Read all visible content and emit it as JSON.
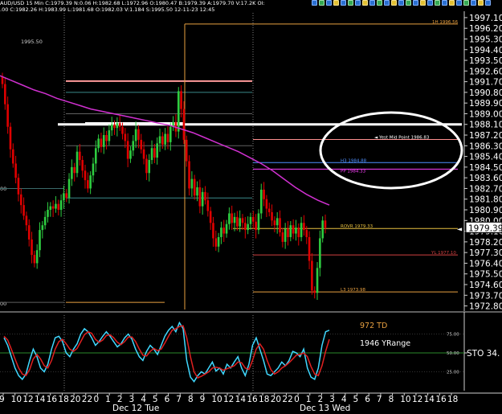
{
  "header": {
    "line1": "AUD/USD  15 Min  C:1979.39  N:0.06  H:1982.68  L:1972.96  O:1980.47  B:1979.39  A:1979.70  V:17.2K  OI:",
    "line2": ".00  C:1982.26  H:1983.99  L:1981.68  O:1982.03  V:1.184  S:1995.50  12-11-23  12:45"
  },
  "colors": {
    "background": "#000000",
    "candle_up": "#2ecc40",
    "candle_down": "#e00000",
    "moving_average": "#d030d0",
    "axis_text": "#ffffff",
    "level_orange": "#e8a040",
    "level_red": "#d04040",
    "level_blue": "#5090ff",
    "level_magenta": "#ff40ff",
    "level_pink": "#ff9090",
    "stoch_fast": "#40d8ff",
    "stoch_slow": "#e02020",
    "stoch_ref": "#2a8a2a",
    "sep_dotted": "#808080"
  },
  "chart_data": [
    {
      "type": "candlestick",
      "title": "AUD/USD 15 Min",
      "ylim": [
        1972.5,
        1997.5
      ],
      "y_ticks": [
        "1997.10",
        "1996.20",
        "1995.30",
        "1994.40",
        "1993.50",
        "1992.60",
        "1991.70",
        "1990.80",
        "1989.90",
        "1989.00",
        "1988.10",
        "1987.20",
        "1986.30",
        "1985.40",
        "1984.50",
        "1983.60",
        "1982.70",
        "1981.80",
        "1980.90",
        "1980.00",
        "1979.10",
        "1978.20",
        "1977.30",
        "1976.40",
        "1975.50",
        "1974.60",
        "1973.70",
        "1972.80"
      ],
      "left_edge_labels": [
        "1995.50",
        "00",
        "00"
      ],
      "current_price": "1979.39",
      "closes": [
        1991.5,
        1989.8,
        1987.9,
        1986.0,
        1984.8,
        1983.6,
        1982.2,
        1981.3,
        1980.4,
        1979.6,
        1978.4,
        1977.1,
        1976.4,
        1977.5,
        1979.2,
        1979.6,
        1980.3,
        1980.9,
        1981.2,
        1981.0,
        1981.4,
        1980.9,
        1981.7,
        1982.3,
        1981.9,
        1983.5,
        1984.5,
        1984.0,
        1985.8,
        1985.1,
        1984.2,
        1983.4,
        1982.7,
        1983.8,
        1984.8,
        1986.1,
        1986.9,
        1986.2,
        1987.2,
        1986.7,
        1987.6,
        1988.1,
        1987.8,
        1988.2,
        1987.9,
        1987.3,
        1986.7,
        1985.2,
        1985.9,
        1986.7,
        1987.7,
        1986.8,
        1986.0,
        1985.2,
        1984.0,
        1985.1,
        1986.1,
        1985.3,
        1986.5,
        1987.1,
        1986.4,
        1987.3,
        1986.6,
        1987.9,
        1988.3,
        1987.5,
        1990.9,
        1989.4,
        1986.8,
        1985.0,
        1982.7,
        1983.5,
        1982.1,
        1982.8,
        1981.2,
        1982.4,
        1981.7,
        1980.8,
        1979.8,
        1978.5,
        1977.8,
        1978.6,
        1979.4,
        1978.9,
        1979.7,
        1980.6,
        1979.8,
        1980.3,
        1979.5,
        1980.2,
        1979.8,
        1979.2,
        1979.7,
        1980.3,
        1979.9,
        1979.2,
        1980.6,
        1982.6,
        1981.8,
        1981.0,
        1980.7,
        1980.0,
        1979.6,
        1980.2,
        1979.0,
        1978.2,
        1979.3,
        1978.6,
        1979.6,
        1978.9,
        1979.4,
        1978.6,
        1979.8,
        1979.2,
        1978.6,
        1976.6,
        1974.1,
        1973.9,
        1976.0,
        1978.5,
        1980.0,
        1979.39
      ],
      "moving_average": [
        1992.2,
        1991.8,
        1991.4,
        1991.0,
        1990.7,
        1990.3,
        1990.0,
        1989.7,
        1989.4,
        1989.2,
        1989.0,
        1988.8,
        1988.6,
        1988.4,
        1988.2,
        1988.0,
        1987.7,
        1987.4,
        1987.0,
        1986.6,
        1986.2,
        1985.8,
        1985.3,
        1984.8,
        1984.2,
        1983.5,
        1982.8,
        1982.2,
        1981.7,
        1981.3
      ],
      "levels": [
        {
          "label": "1H 1996.56",
          "value": 1996.56,
          "color": "#e8a040"
        },
        {
          "label": "Yest Mid Point 1986.83",
          "value": 1986.83,
          "color": "#ff9090",
          "marker": "◄"
        },
        {
          "label": "H3 1984.88",
          "value": 1984.88,
          "color": "#5090ff"
        },
        {
          "label": "PP 1984.33",
          "value": 1984.33,
          "color": "#ff40ff"
        },
        {
          "label": "ROVR 1979.33",
          "value": 1979.33,
          "color": "#e8c040"
        },
        {
          "label": "YL 1977.10",
          "value": 1977.1,
          "color": "#d04040"
        },
        {
          "label": "L3 1973.98",
          "value": 1973.98,
          "color": "#e8a040"
        }
      ],
      "highlight_line": 1988.1
    },
    {
      "type": "line",
      "series": [
        {
          "name": "",
          "color": "#40d8ff",
          "values": [
            70,
            60,
            45,
            30,
            20,
            15,
            22,
            40,
            55,
            45,
            30,
            25,
            35,
            55,
            70,
            72,
            65,
            50,
            45,
            55,
            62,
            75,
            82,
            78,
            70,
            60,
            65,
            72,
            78,
            72,
            65,
            58,
            62,
            70,
            75,
            68,
            55,
            45,
            40,
            52,
            60,
            55,
            48,
            60,
            72,
            80,
            85,
            78,
            90,
            82,
            40,
            18,
            12,
            20,
            25,
            22,
            30,
            38,
            26,
            30,
            22,
            35,
            30,
            38,
            45,
            30,
            20,
            35,
            60,
            70,
            55,
            40,
            22,
            20,
            25,
            30,
            38,
            33,
            40,
            52,
            50,
            45,
            55,
            30,
            18,
            15,
            30,
            60,
            78,
            80
          ]
        },
        {
          "name": "",
          "color": "#e02020",
          "values": [
            72,
            67,
            55,
            42,
            30,
            22,
            20,
            28,
            42,
            48,
            42,
            33,
            30,
            40,
            55,
            65,
            68,
            62,
            55,
            52,
            56,
            65,
            74,
            78,
            76,
            68,
            64,
            67,
            73,
            74,
            70,
            64,
            61,
            65,
            71,
            71,
            65,
            55,
            47,
            46,
            52,
            56,
            53,
            55,
            63,
            72,
            80,
            82,
            85,
            86,
            70,
            45,
            25,
            17,
            19,
            22,
            25,
            30,
            31,
            30,
            27,
            29,
            31,
            33,
            38,
            37,
            30,
            28,
            40,
            55,
            62,
            55,
            40,
            28,
            22,
            25,
            30,
            33,
            37,
            42,
            47,
            48,
            50,
            45,
            32,
            22,
            20,
            33,
            52,
            68
          ]
        }
      ],
      "ylim": [
        0,
        100
      ],
      "ref_lines": [
        25,
        50,
        75
      ],
      "right_labels": [
        "75.00",
        "50.00",
        "25.00"
      ],
      "annotations": [
        "972 TD",
        "1946 YRange"
      ],
      "right_tag": "STO  34."
    }
  ],
  "x_axis": {
    "labels": [
      "9",
      "10",
      "12",
      "14",
      "16",
      "18",
      "20",
      "22",
      "0",
      "1",
      "2",
      "3",
      "4",
      "5",
      "6",
      "7",
      "8",
      "9",
      "10",
      "12",
      "14",
      "16",
      "18",
      "20",
      "22",
      "0",
      "1",
      "2",
      "3",
      "4",
      "5",
      "6",
      "7",
      "8",
      "10",
      "12",
      "14",
      "16",
      "18"
    ],
    "day_labels": [
      "Dec 12 Tue",
      "Dec 13 Wed"
    ]
  }
}
